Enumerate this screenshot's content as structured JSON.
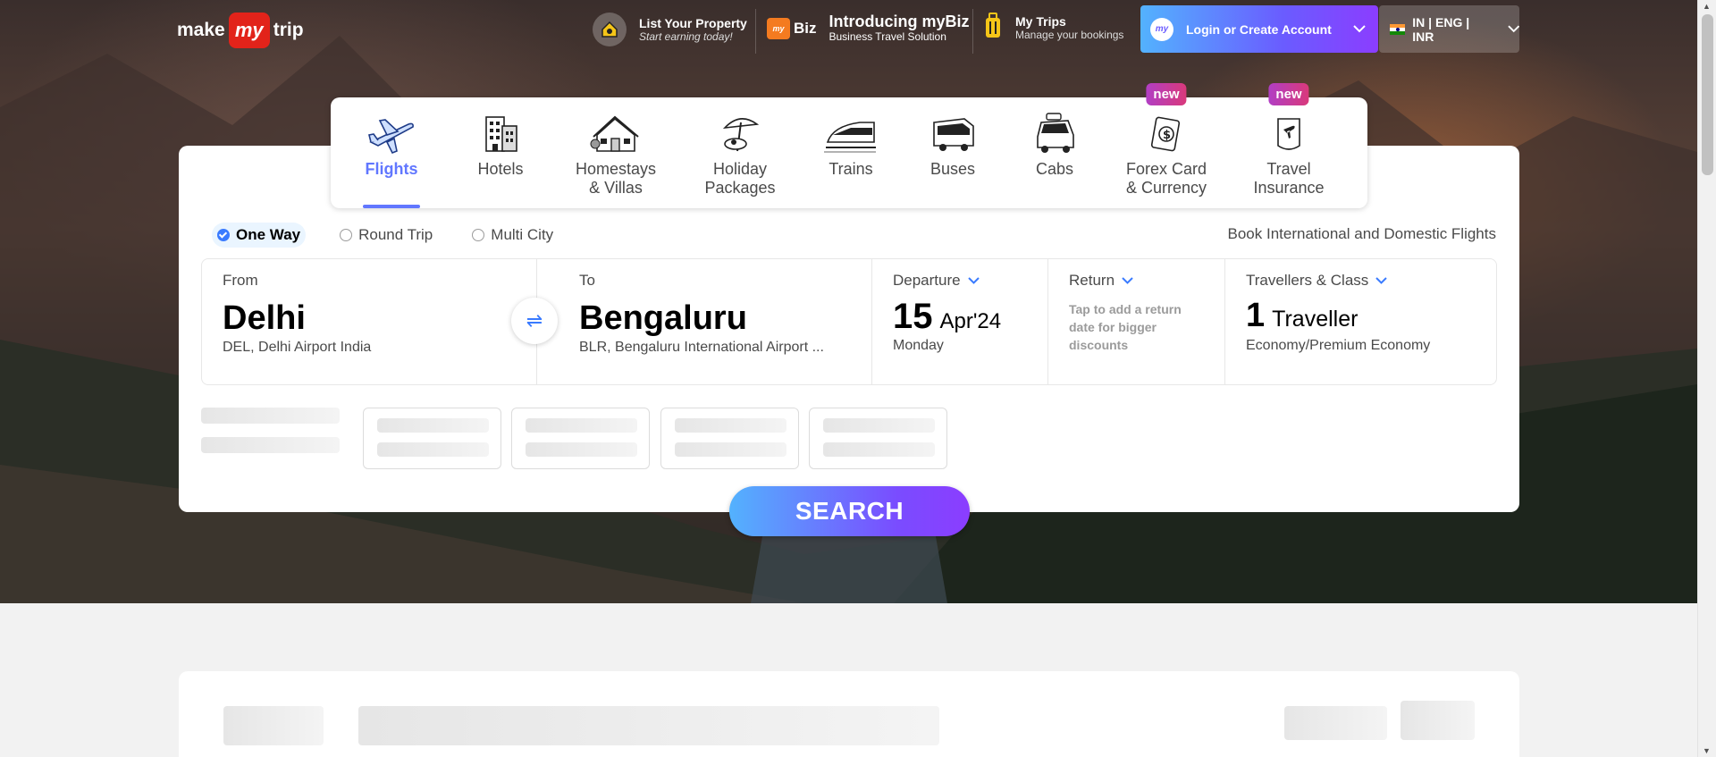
{
  "brand": {
    "logo_left": "make",
    "logo_mid": "my",
    "logo_right": "trip"
  },
  "header": {
    "list_property": {
      "title": "List Your Property",
      "subtitle": "Start earning today!"
    },
    "mybiz": {
      "badge": "Biz",
      "title": "Introducing myBiz",
      "subtitle": "Business Travel Solution"
    },
    "my_trips": {
      "title": "My Trips",
      "subtitle": "Manage your bookings"
    },
    "login": {
      "label": "Login or Create Account",
      "avatar": "my"
    },
    "locale": {
      "label": "IN | ENG | INR"
    }
  },
  "tabs": [
    {
      "label1": "Flights",
      "label2": "",
      "icon": "flight-icon",
      "active": true
    },
    {
      "label1": "Hotels",
      "label2": "",
      "icon": "hotel-icon"
    },
    {
      "label1": "Homestays",
      "label2": "& Villas",
      "icon": "homestay-icon"
    },
    {
      "label1": "Holiday",
      "label2": "Packages",
      "icon": "holiday-icon"
    },
    {
      "label1": "Trains",
      "label2": "",
      "icon": "train-icon"
    },
    {
      "label1": "Buses",
      "label2": "",
      "icon": "bus-icon"
    },
    {
      "label1": "Cabs",
      "label2": "",
      "icon": "cab-icon"
    },
    {
      "label1": "Forex Card",
      "label2": "& Currency",
      "icon": "forex-icon",
      "badge": "new"
    },
    {
      "label1": "Travel",
      "label2": "Insurance",
      "icon": "insurance-icon",
      "badge": "new"
    }
  ],
  "trip_types": [
    {
      "label": "One Way",
      "selected": true
    },
    {
      "label": "Round Trip",
      "selected": false
    },
    {
      "label": "Multi City",
      "selected": false
    }
  ],
  "book_intl": "Book International and Domestic Flights",
  "from": {
    "label": "From",
    "city": "Delhi",
    "airport": "DEL, Delhi Airport India"
  },
  "to": {
    "label": "To",
    "city": "Bengaluru",
    "airport": "BLR, Bengaluru International Airport ..."
  },
  "departure": {
    "label": "Departure",
    "day": "15",
    "month_year": "Apr'24",
    "weekday": "Monday"
  },
  "return": {
    "label": "Return",
    "hint": "Tap to add a return date for bigger discounts"
  },
  "travellers": {
    "label": "Travellers & Class",
    "count": "1",
    "unit": "Traveller",
    "class": "Economy/Premium Economy"
  },
  "search_label": "SEARCH",
  "colors": {
    "accent": "#6177ff",
    "brand_red": "#e2231a",
    "gradient_start": "#53b2fe",
    "gradient_end": "#8b3dff"
  }
}
